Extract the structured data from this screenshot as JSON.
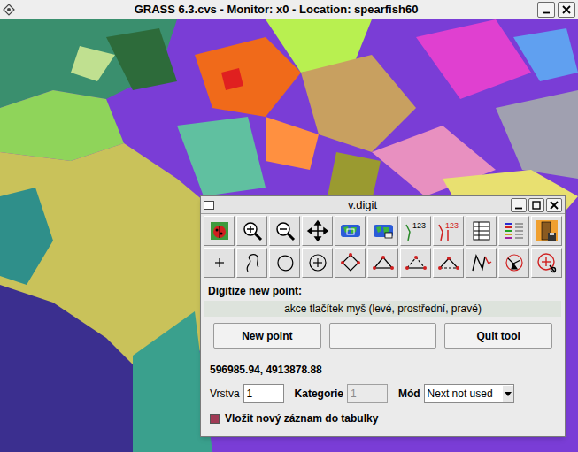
{
  "window": {
    "title": "GRASS 6.3.cvs - Monitor: x0 - Location: spearfish60"
  },
  "dialog": {
    "title": "v.digit",
    "toolbar": [
      [
        {
          "kind": "display-settings"
        },
        {
          "kind": "zoom-in"
        },
        {
          "kind": "zoom-out"
        },
        {
          "kind": "pan"
        },
        {
          "kind": "zoom-region"
        },
        {
          "kind": "zoom-default"
        },
        {
          "kind": "display-cats",
          "label": "123"
        },
        {
          "kind": "copy-cats",
          "label": "123"
        },
        {
          "kind": "attributes"
        },
        {
          "kind": "settings"
        },
        {
          "kind": "exit"
        }
      ],
      [
        {
          "kind": "new-point"
        },
        {
          "kind": "new-line"
        },
        {
          "kind": "new-boundary"
        },
        {
          "kind": "new-centroid"
        },
        {
          "kind": "move-vertex"
        },
        {
          "kind": "add-vertex"
        },
        {
          "kind": "remove-vertex"
        },
        {
          "kind": "split-line"
        },
        {
          "kind": "edit-line"
        },
        {
          "kind": "move-line"
        },
        {
          "kind": "delete-line"
        }
      ]
    ],
    "prompt": "Digitize new point:",
    "mouse_hint": "akce tlačítek myš (levé, prostřední, pravé)",
    "mouse_buttons": [
      "New point",
      "",
      "Quit tool"
    ],
    "coordinates": "596985.94, 4913878.88",
    "layer": {
      "label": "Vrstva",
      "value": "1"
    },
    "category": {
      "label": "Kategorie",
      "value": "1",
      "disabled": true
    },
    "mode": {
      "label": "Mód",
      "value": "Next not used"
    },
    "insert_record": {
      "label": "Vložit nový záznam do tabulky",
      "checked": true
    }
  }
}
